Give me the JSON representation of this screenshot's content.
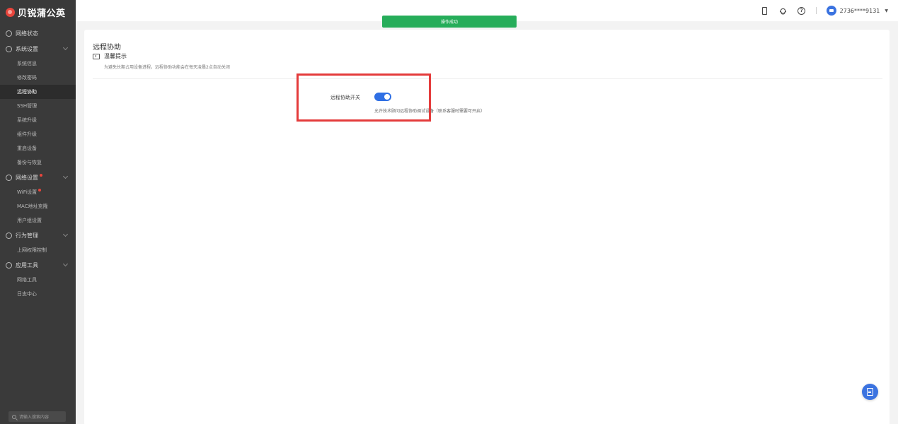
{
  "brand": {
    "name": "贝锐蒲公英"
  },
  "sidebar": {
    "groups": [
      {
        "label": "网络状态",
        "icon": "globe-icon",
        "items": []
      },
      {
        "label": "系统设置",
        "icon": "gear-icon",
        "items": [
          "系统信息",
          "修改密码",
          "远程协助",
          "SSH管理",
          "系统升级",
          "组件升级",
          "重启设备",
          "备份与恢复"
        ]
      },
      {
        "label": "网络设置",
        "icon": "network-icon",
        "items": [
          "WiFi设置",
          "MAC地址克隆",
          "用户组设置"
        ]
      },
      {
        "label": "行为管理",
        "icon": "behavior-icon",
        "items": [
          "上网权限控制"
        ]
      },
      {
        "label": "应用工具",
        "icon": "tools-icon",
        "items": [
          "网络工具",
          "日志中心"
        ]
      }
    ],
    "active_item": "远程协助",
    "search_placeholder": "请输入搜索内容"
  },
  "topbar": {
    "user": "2736****9131",
    "icons": [
      "phone-icon",
      "headset-icon",
      "help-icon"
    ]
  },
  "toast": {
    "text": "操作成功"
  },
  "content": {
    "title": "远程协助",
    "tip_title": "温馨提示",
    "tip_desc": "为避免长期占用设备进程，远程协助功能会在每天凌晨2点自动关闭",
    "switch_label": "远程协助开关",
    "switch_on": true,
    "switch_desc": "允许技术顾问远程协助调试设备（联系客服时需要可开启）"
  },
  "colors": {
    "accent": "#2f6fe4",
    "toast": "#26ad5a",
    "highlight": "#e43b3b",
    "sidebar": "#3a3a3a"
  }
}
